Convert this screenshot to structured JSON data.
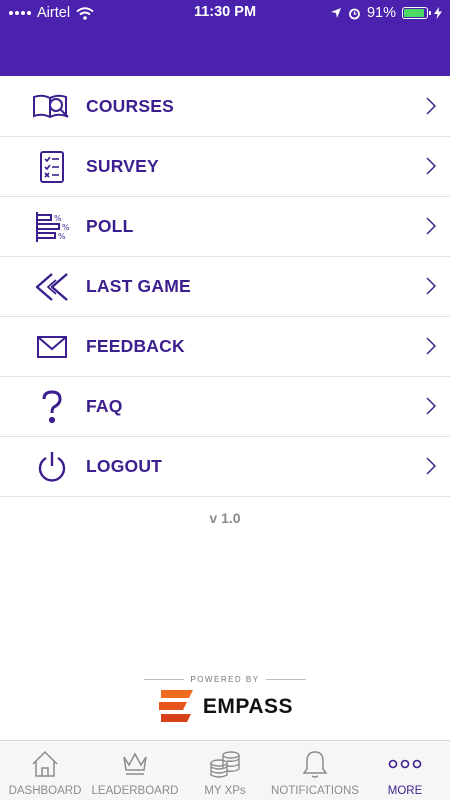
{
  "status_bar": {
    "carrier": "Airtel",
    "time": "11:30 PM",
    "battery": "91%",
    "battery_level": 0.91
  },
  "colors": {
    "header": "#4a22ad",
    "accent": "#3c1e8e",
    "battery": "#4cd964"
  },
  "menu": {
    "items": [
      {
        "label": "COURSES",
        "icon": "book-search-icon"
      },
      {
        "label": "SURVEY",
        "icon": "survey-checklist-icon"
      },
      {
        "label": "POLL",
        "icon": "poll-bars-icon"
      },
      {
        "label": "LAST GAME",
        "icon": "rewind-icon"
      },
      {
        "label": "FEEDBACK",
        "icon": "envelope-icon"
      },
      {
        "label": "FAQ",
        "icon": "question-mark-icon"
      },
      {
        "label": "LOGOUT",
        "icon": "power-icon"
      }
    ]
  },
  "version": "v 1.0",
  "branding": {
    "powered_by": "POWERED BY",
    "name": "EMPASS"
  },
  "tabbar": {
    "tabs": [
      {
        "label": "DASHBOARD",
        "icon": "home-icon"
      },
      {
        "label": "LEADERBOARD",
        "icon": "crown-icon"
      },
      {
        "label": "MY XPs",
        "icon": "coins-icon"
      },
      {
        "label": "NOTIFICATIONS",
        "icon": "bell-icon"
      },
      {
        "label": "MORE",
        "icon": "more-dots-icon"
      }
    ],
    "active": "MORE"
  }
}
